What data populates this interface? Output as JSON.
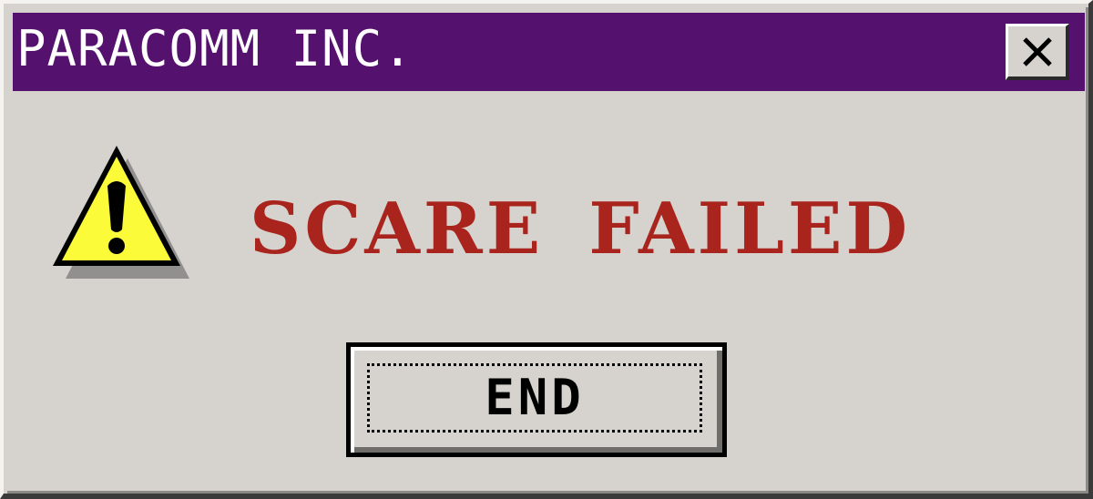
{
  "window": {
    "title": "PARACOMM INC.",
    "close_icon": "close-icon",
    "title_bar_color": "#55116e",
    "background_color": "#d6d3ce"
  },
  "dialog": {
    "icon": "warning-icon",
    "message": "SCARE FAILED",
    "message_color": "#a8241c"
  },
  "buttons": {
    "end_label": "END"
  }
}
